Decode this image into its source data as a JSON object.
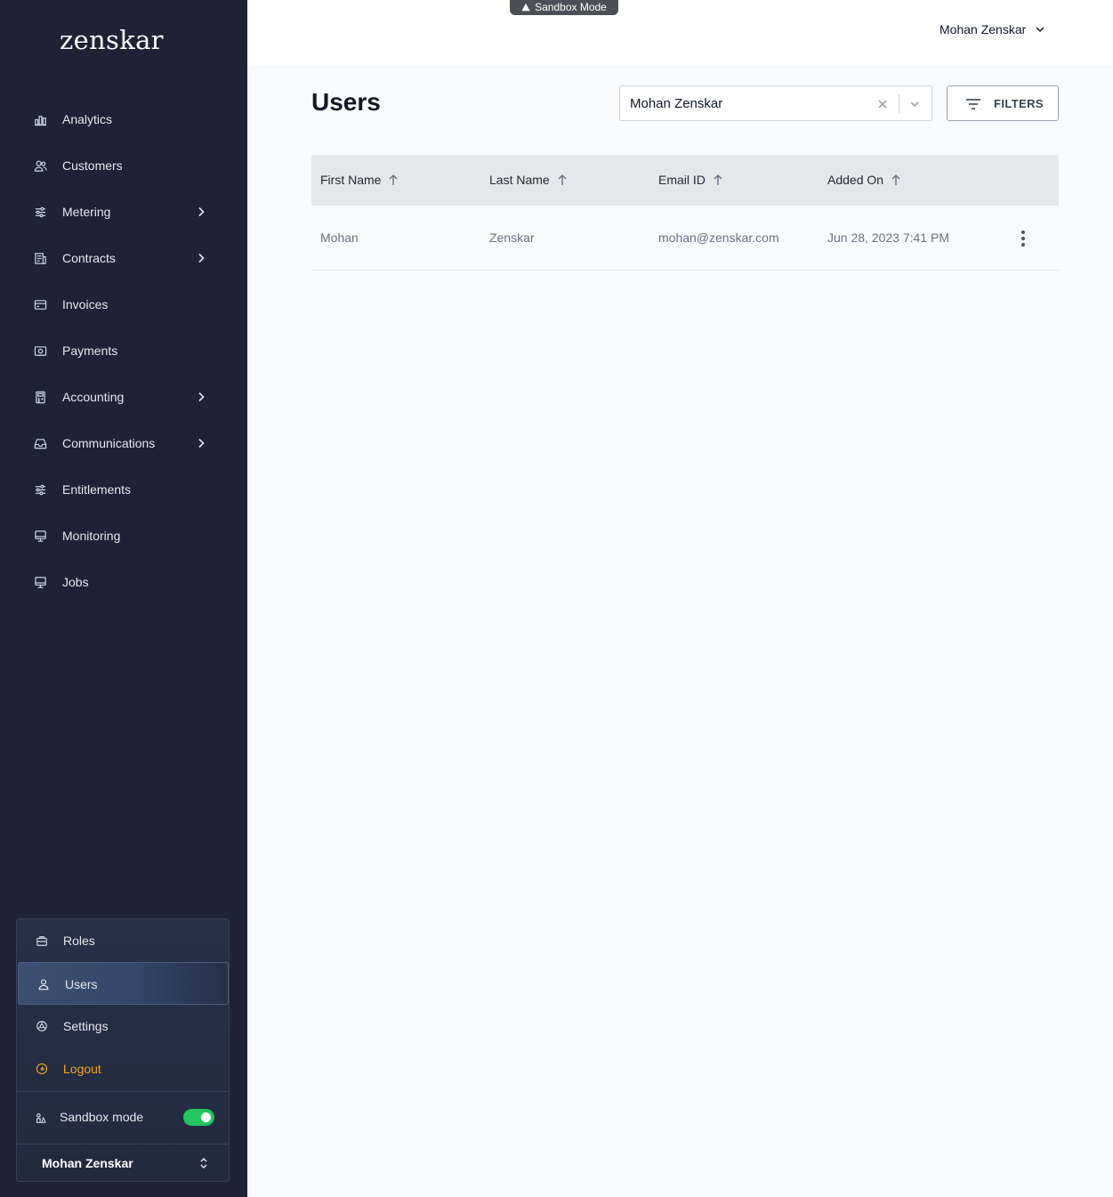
{
  "app": {
    "logo_text": "zenskar",
    "sandbox_badge": "Sandbox Mode"
  },
  "sidebar": {
    "items": [
      {
        "label": "Analytics",
        "icon": "bar-chart-icon",
        "has_submenu": false
      },
      {
        "label": "Customers",
        "icon": "users-icon",
        "has_submenu": false
      },
      {
        "label": "Metering",
        "icon": "sliders-icon",
        "has_submenu": true
      },
      {
        "label": "Contracts",
        "icon": "contract-icon",
        "has_submenu": true
      },
      {
        "label": "Invoices",
        "icon": "credit-card-icon",
        "has_submenu": false
      },
      {
        "label": "Payments",
        "icon": "money-icon",
        "has_submenu": false
      },
      {
        "label": "Accounting",
        "icon": "calculator-icon",
        "has_submenu": true
      },
      {
        "label": "Communications",
        "icon": "inbox-icon",
        "has_submenu": true
      },
      {
        "label": "Entitlements",
        "icon": "sliders-icon",
        "has_submenu": false
      },
      {
        "label": "Monitoring",
        "icon": "monitor-icon",
        "has_submenu": false
      },
      {
        "label": "Jobs",
        "icon": "monitor-icon",
        "has_submenu": false
      }
    ],
    "bottom_items": [
      {
        "label": "Roles",
        "icon": "briefcase-icon",
        "active": false
      },
      {
        "label": "Users",
        "icon": "user-icon",
        "active": true
      },
      {
        "label": "Settings",
        "icon": "settings-icon",
        "active": false
      },
      {
        "label": "Logout",
        "icon": "logout-icon",
        "active": false
      }
    ],
    "sandbox_label": "Sandbox mode",
    "sandbox_enabled": true,
    "current_user": "Mohan Zenskar"
  },
  "header": {
    "account_name": "Mohan Zenskar"
  },
  "main": {
    "title": "Users",
    "user_select": {
      "value": "Mohan Zenskar"
    },
    "filters_label": "FILTERS",
    "table": {
      "columns": [
        "First Name",
        "Last Name",
        "Email ID",
        "Added On"
      ],
      "rows": [
        [
          "Mohan",
          "Zenskar",
          "mohan@zenskar.com",
          "Jun 28, 2023 7:41 PM"
        ]
      ]
    }
  },
  "colors": {
    "sidebar_bg": "#1d2235",
    "accent_logout": "#f5a524",
    "toggle_on": "#22c55e"
  }
}
